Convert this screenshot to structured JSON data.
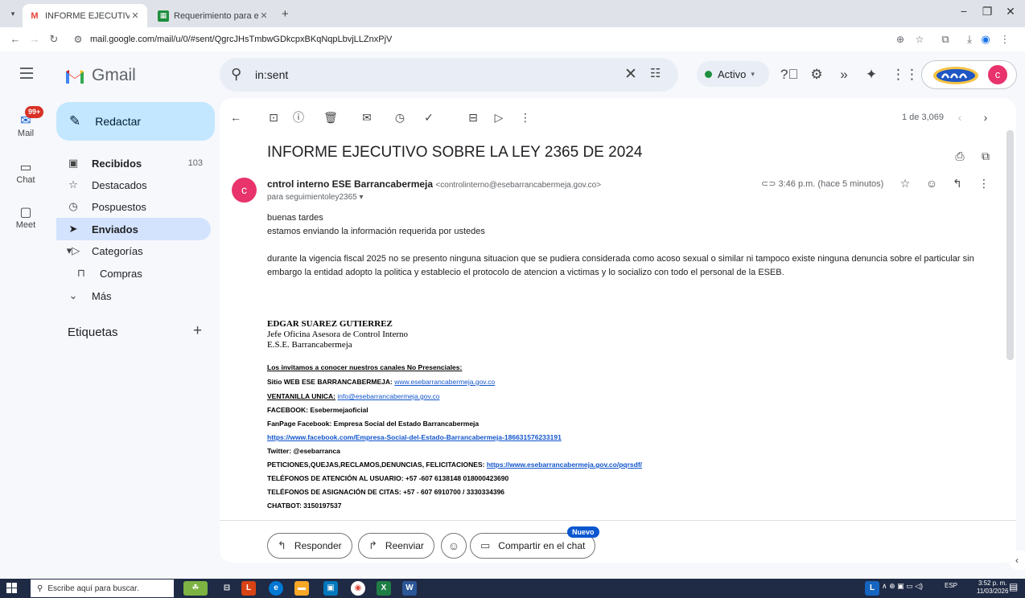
{
  "browser": {
    "tabs": [
      {
        "title": "INFORME EJECUTIVO SOBRE LA",
        "favicon": "gmail-icon",
        "active": true
      },
      {
        "title": "Requerimiento para el cumplim",
        "favicon": "sheets-icon",
        "active": false
      }
    ],
    "new_tab": "+",
    "url": "mail.google.com/mail/u/0/#sent/QgrcJHsTmbwGDkcpxBKqNqpLbvjLLZnxPjV"
  },
  "gmail": {
    "brand": "Gmail",
    "search": {
      "value": "in:sent"
    },
    "status": {
      "label": "Activo",
      "color": "#1e8e3e"
    },
    "account_initial": "c",
    "rail": {
      "mail": {
        "label": "Mail",
        "badge": "99+"
      },
      "chat": {
        "label": "Chat"
      },
      "meet": {
        "label": "Meet"
      }
    },
    "compose": {
      "label": "Redactar"
    },
    "nav": {
      "inbox": {
        "label": "Recibidos",
        "count": "103"
      },
      "starred": {
        "label": "Destacados"
      },
      "snoozed": {
        "label": "Pospuestos"
      },
      "sent": {
        "label": "Enviados"
      },
      "categories": {
        "label": "Categorías"
      },
      "purchases": {
        "label": "Compras"
      },
      "more": {
        "label": "Más"
      }
    },
    "labels_title": "Etiquetas"
  },
  "email": {
    "pager": "1 de 3,069",
    "subject": "INFORME EJECUTIVO SOBRE LA LEY 2365 DE 2024",
    "sender_initial": "c",
    "from_name": "cntrol interno ESE Barrancabermeja",
    "from_email": "<controlinterno@esebarrancabermeja.gov.co>",
    "to": "para seguimientoley2365",
    "time": "3:46 p.m. (hace 5 minutos)",
    "body": {
      "line1": "buenas tardes",
      "line2": "estamos enviando la información requerida por ustedes",
      "line3": "durante la vigencia fiscal 2025 no se presento ninguna situacion que se pudiera considerada como acoso sexual o similar ni tampoco existe ninguna denuncia sobre el particular   sin",
      "line4": "embargo la entidad adopto la politica y establecio el protocolo de atencion a victimas y lo socializo con todo el personal de la ESEB."
    },
    "signature": {
      "name": "EDGAR SUAREZ GUTIERREZ",
      "role": "Jefe Oficina Asesora de Control Interno",
      "org": "E.S.E. Barrancabermeja",
      "invite": "Los invitamos a conocer nuestros canales No Presenciales:",
      "web_label": "Sitio WEB ESE BARRANCABERMEJA:",
      "web_link": "www.esebarrancabermeja.gov.co",
      "window_label": "VENTANILLA UNICA:",
      "window_link": "info@esebarrancabermeja.gov.co",
      "facebook": "FACEBOOK: Esebermejaoficial",
      "fanpage": "FanPage Facebook:  Empresa Social del Estado Barrancabermeja",
      "fanpage_link": "https://www.facebook.com/Empresa-Social-del-Estado-Barrancabermeja-186631576233191",
      "twitter": "Twitter: @esebarranca",
      "pqrs_label": "PETICIONES,QUEJAS,RECLAMOS,DENUNCIAS, FELICITACIONES:",
      "pqrs_link": "https://www.esebarrancabermeja.gov.co/pqrsdf/",
      "phones": "TELÉFONOS DE ATENCIÓN AL USUARIO:  +57 -607 6138148 018000423690",
      "appointments": "TELÉFONOS DE ASIGNACIÓN DE CITAS:  +57 - 607 6910700 /  3330334396",
      "chatbot": "CHATBOT: 3150197537"
    },
    "actions": {
      "reply": "Responder",
      "forward": "Reenviar",
      "share": "Compartir en el chat",
      "new_badge": "Nuevo"
    }
  },
  "taskbar": {
    "search_placeholder": "Escribe aquí para buscar.",
    "language": "ESP",
    "time": "3:52 p. m.",
    "date": "11/03/2026"
  }
}
